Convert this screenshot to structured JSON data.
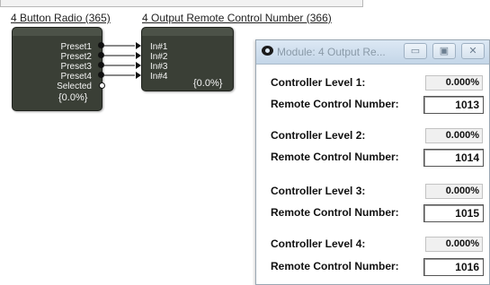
{
  "canvas": {
    "block1": {
      "title": "4 Button Radio (365)",
      "outputs": [
        "Preset1",
        "Preset2",
        "Preset3",
        "Preset4",
        "Selected"
      ],
      "value": "{0.0%}"
    },
    "block2": {
      "title": "4 Output Remote Control Number (366)",
      "inputs": [
        "In#1",
        "In#2",
        "In#3",
        "In#4"
      ],
      "value": "{0.0%}"
    }
  },
  "window": {
    "title": "Module: 4 Output Re...",
    "buttons": {
      "minimize": "▭",
      "maximize": "▣",
      "close": "✕"
    },
    "controllers": [
      {
        "level_label": "Controller Level 1:",
        "level_value": "0.000%",
        "rcn_label": "Remote Control Number:",
        "rcn_value": "1013"
      },
      {
        "level_label": "Controller Level 2:",
        "level_value": "0.000%",
        "rcn_label": "Remote Control Number:",
        "rcn_value": "1014"
      },
      {
        "level_label": "Controller Level 3:",
        "level_value": "0.000%",
        "rcn_label": "Remote Control Number:",
        "rcn_value": "1015"
      },
      {
        "level_label": "Controller Level 4:",
        "level_value": "0.000%",
        "rcn_label": "Remote Control Number:",
        "rcn_value": "1016"
      }
    ]
  }
}
